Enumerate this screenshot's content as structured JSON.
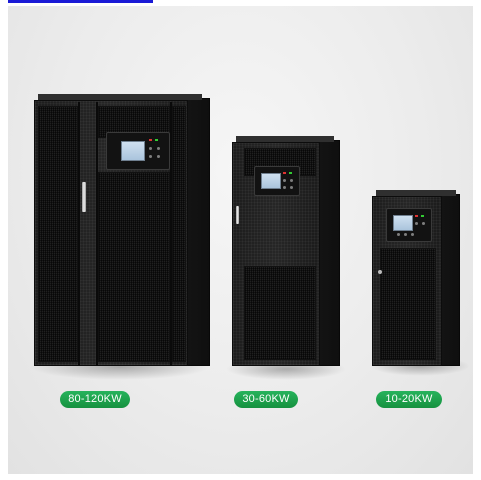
{
  "products": [
    {
      "label": "80-120KW"
    },
    {
      "label": "30-60KW"
    },
    {
      "label": "10-20KW"
    }
  ],
  "colors": {
    "label_bg": "#1a9a48",
    "cabinet": "#1f1f1f",
    "background": "#ececec"
  }
}
